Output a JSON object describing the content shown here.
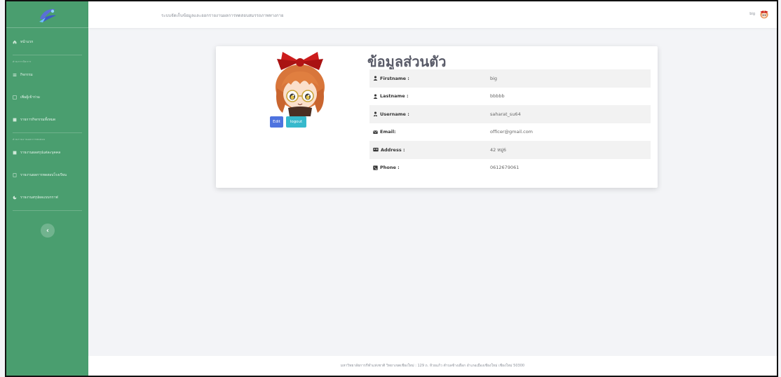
{
  "topbar": {
    "title": "ระบบจัดเก็บข้อมูลและออกรายงานผลการทดสอบสมรรถภาพทางกาย",
    "user_name": "big"
  },
  "sidebar": {
    "items": [
      {
        "label": "หน้าแรก",
        "icon": "home-icon"
      },
      {
        "heading": "ส่วนการจัดการ"
      },
      {
        "label": "กิจกรรม",
        "icon": "list-icon"
      },
      {
        "label": "เพิ่มผู้เข้าร่วม",
        "icon": "user-plus-icon"
      },
      {
        "label": "รายการกิจกรรมทั้งหมด",
        "icon": "table-icon"
      },
      {
        "heading": "ส่วนรายงานผลการทดสอบ"
      },
      {
        "label": "รายงานผลสรุปแต่ละบุคคล",
        "icon": "report-icon"
      },
      {
        "label": "รายงานผลการทดสอบโรงเรียน",
        "icon": "file-icon"
      },
      {
        "label": "รายงานสรุปผลแบบกราฟ",
        "icon": "chart-icon"
      }
    ]
  },
  "profile": {
    "title": "ข้อมูลส่วนตัว",
    "edit_label": "Edit",
    "logout_label": "logout",
    "rows": [
      {
        "label": "Firstname :",
        "value": "big",
        "icon": "user-icon"
      },
      {
        "label": "Lastname :",
        "value": "bbbbb",
        "icon": "user-icon"
      },
      {
        "label": "Username :",
        "value": "saharat_su64",
        "icon": "user-tie-icon"
      },
      {
        "label": "Email:",
        "value": "officer@gmail.com",
        "icon": "envelope-icon"
      },
      {
        "label": "Address :",
        "value": "42 หมู่6",
        "icon": "address-card-icon"
      },
      {
        "label": "Phone :",
        "value": "0612679061",
        "icon": "phone-square-icon"
      }
    ]
  },
  "footer": {
    "text": "มหาวิทยาลัยการกีฬาแห่งชาติ วิทยาเขตเชียงใหม่ : 129 ถ. ห้วยแก้ว ตำบลช้างเผือก อำเภอเมืองเชียงใหม่ เชียงใหม่ 50300"
  },
  "colors": {
    "sidebar": "#4a9e6f",
    "edit_button": "#4e73df",
    "logout_button": "#36b9cc"
  }
}
